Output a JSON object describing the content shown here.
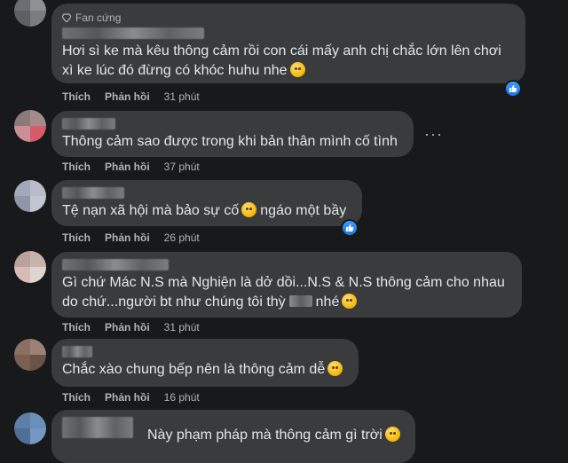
{
  "labels": {
    "like": "Thích",
    "reply": "Phản hồi"
  },
  "comments": [
    {
      "badge": "Fan cứng",
      "text_lines": [
        "Hơi sì ke mà kêu thông cảm rồi con cái mấy anh chị chắc lớn lên chơi",
        "xì ke lúc đó đừng có khóc huhu nhe"
      ],
      "emoji": "tired-face",
      "time": "31 phút",
      "reaction": "like"
    },
    {
      "text_lines": [
        "Thông cảm sao được trong khi bản thân mình cố tình"
      ],
      "time": "37 phút",
      "more_label": "···"
    },
    {
      "text_lines": [
        "Tệ nạn xã hội mà bảo sự cố",
        "ngáo một bầy"
      ],
      "emoji": "rofl-face",
      "time": "26 phút",
      "reaction": "like"
    },
    {
      "text_lines": [
        "Gì chứ Mác N.S mà Nghiện là dở dồi...N.S & N.S thông cảm cho nhau",
        "do chứ...người bt như chúng tôi thỳ",
        "nhé"
      ],
      "emoji": "smirk-face",
      "time": "31 phút"
    },
    {
      "text_lines": [
        "Chắc xào chung bếp nên là thông cảm dễ"
      ],
      "emoji": "worried-face",
      "time": "16 phút"
    },
    {
      "text_lines": [
        "Này phạm pháp mà thông cảm gì trời"
      ],
      "emoji": "upside-down-face"
    }
  ],
  "colors": {
    "background": "#18191a",
    "bubble": "#3a3b3c",
    "text": "#e4e6eb",
    "muted": "#b0b3b8",
    "like_blue": "#1877f2"
  }
}
